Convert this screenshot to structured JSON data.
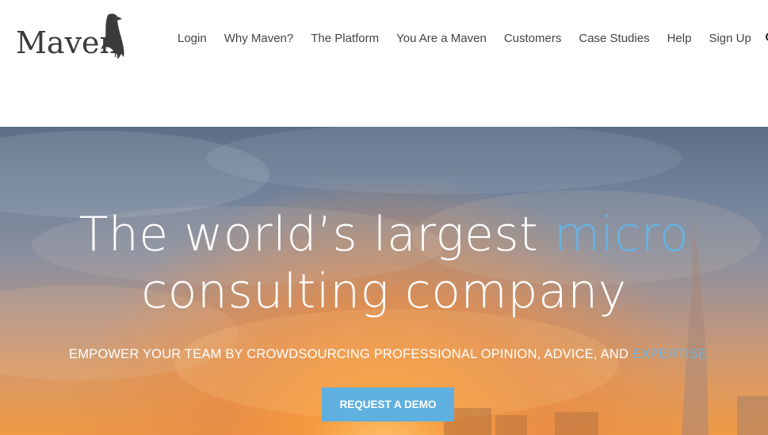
{
  "brand": {
    "name": "Maven"
  },
  "nav": {
    "items": [
      "Login",
      "Why Maven?",
      "The Platform",
      "You Are a Maven",
      "Customers",
      "Case Studies",
      "Help",
      "Sign Up"
    ],
    "search_icon": "search-icon"
  },
  "hero": {
    "headline_part1": "The world’s largest ",
    "headline_accent": "micro",
    "headline_line2": "consulting company",
    "subhead_main": "EMPOWER YOUR TEAM BY CROWDSOURCING PROFESSIONAL OPINION, ADVICE, AND ",
    "subhead_accent": "EXPERTISE",
    "cta_label": "REQUEST A DEMO"
  },
  "colors": {
    "accent": "#67b3e2",
    "button": "#5fb0df",
    "nav_text": "#444444",
    "logo": "#3b3b3b"
  }
}
